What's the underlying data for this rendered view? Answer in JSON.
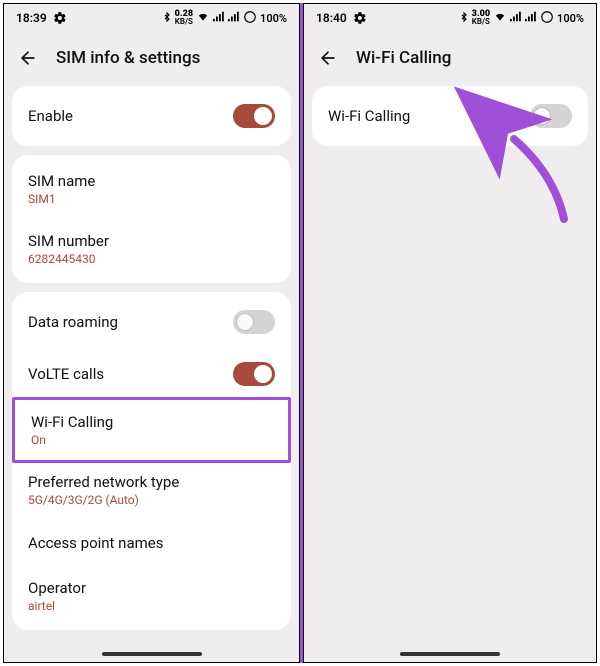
{
  "left": {
    "status": {
      "time": "18:39",
      "net_rate": "0.28",
      "net_unit": "KB/S",
      "battery": "100%"
    },
    "header": {
      "title": "SIM info & settings"
    },
    "enable": {
      "label": "Enable",
      "on": true
    },
    "sim": {
      "name_label": "SIM name",
      "name_value": "SIM1",
      "number_label": "SIM number",
      "number_value": "6282445430"
    },
    "net": {
      "roaming_label": "Data roaming",
      "roaming_on": false,
      "volte_label": "VoLTE calls",
      "volte_on": true,
      "wifi_label": "Wi-Fi Calling",
      "wifi_sub": "On",
      "pref_label": "Preferred network type",
      "pref_sub": "5G/4G/3G/2G (Auto)",
      "apn_label": "Access point names",
      "operator_label": "Operator",
      "operator_sub": "airtel"
    }
  },
  "right": {
    "status": {
      "time": "18:40",
      "net_rate": "3.00",
      "net_unit": "KB/S",
      "battery": "100%"
    },
    "header": {
      "title": "Wi-Fi Calling"
    },
    "row": {
      "label": "Wi-Fi Calling",
      "on": false
    }
  }
}
